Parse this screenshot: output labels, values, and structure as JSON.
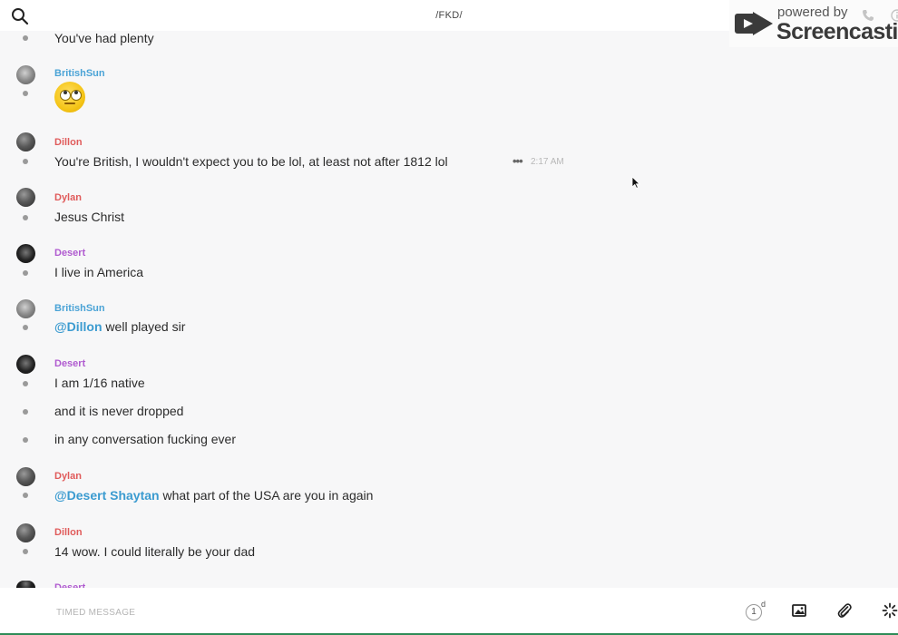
{
  "channel": {
    "title": "/FKD/"
  },
  "watermark": {
    "powered": "powered by",
    "brand": "Screencastify"
  },
  "messages": [
    {
      "text": "You've had plenty"
    },
    {
      "author": "BritishSun"
    },
    {
      "author": "Dillon",
      "text": "You're British, I wouldn't expect you to be lol, at least not after 1812 lol",
      "time": "2:17 AM"
    },
    {
      "author": "Dylan",
      "text": "Jesus Christ"
    },
    {
      "author": "Desert",
      "text": "I live in America"
    },
    {
      "author": "BritishSun",
      "mention": "@Dillon",
      "text": " well played sir"
    },
    {
      "author": "Desert",
      "texts": [
        "I am 1/16 native",
        "and it is never dropped",
        "in any conversation fucking ever"
      ]
    },
    {
      "author": "Dylan",
      "mention": "@Desert Shaytan",
      "text": " what part of the USA are you in again"
    },
    {
      "author": "Dillon",
      "text": "14 wow. I could literally be your dad"
    },
    {
      "author": "Desert"
    }
  ],
  "composer": {
    "placeholder": "TIMED MESSAGE",
    "value": ""
  },
  "timer": {
    "value": "1",
    "unit": "d"
  },
  "colors": {
    "britishsun": "#4aa3d6",
    "dillon": "#e05b5b",
    "dylan": "#e05b5b",
    "desert": "#b05bd0",
    "mention": "#3b9bd0"
  },
  "icons": [
    "search-icon",
    "phone-icon",
    "info-icon",
    "more-options-icon",
    "image-icon",
    "paperclip-icon",
    "loading-spinner-icon",
    "cursor-icon"
  ]
}
